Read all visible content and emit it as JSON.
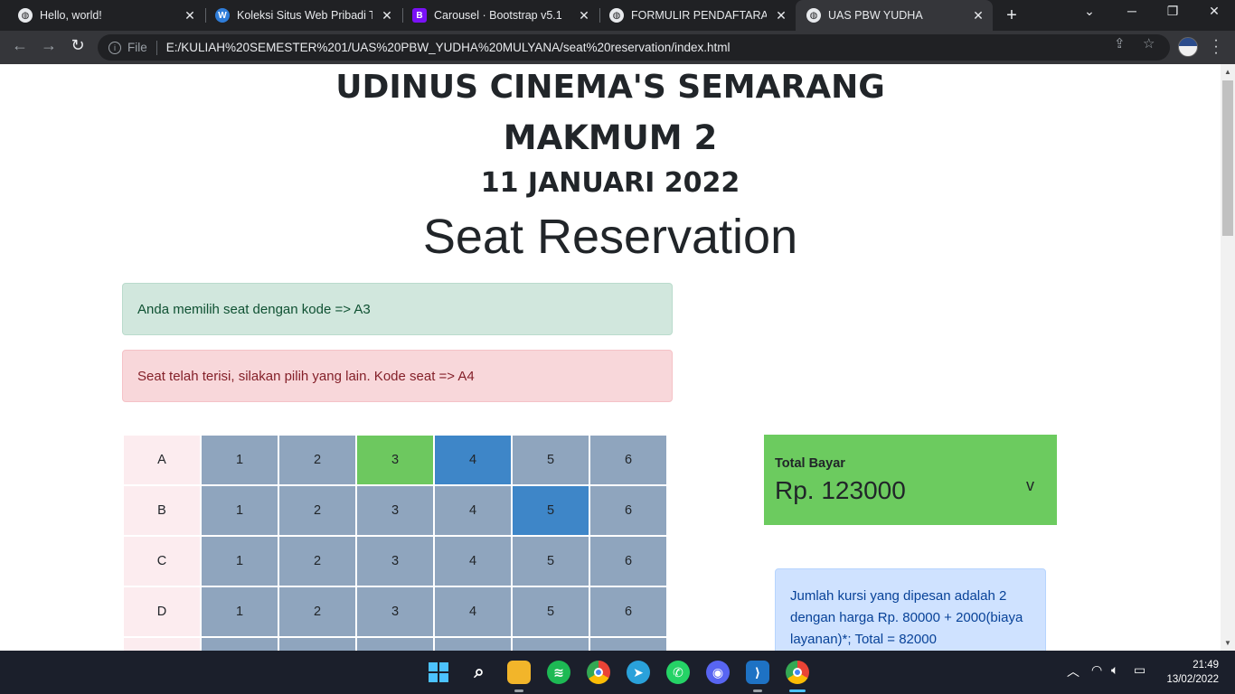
{
  "browser": {
    "tabs": [
      {
        "title": "Hello, world!",
        "icon": "globe-icon"
      },
      {
        "title": "Koleksi Situs Web Pribadi Ter",
        "icon": "wordpress-icon"
      },
      {
        "title": "Carousel · Bootstrap v5.1",
        "icon": "bootstrap-icon"
      },
      {
        "title": "FORMULIR PENDAFTARAN",
        "icon": "globe-icon"
      },
      {
        "title": "UAS PBW YUDHA",
        "icon": "globe-icon"
      }
    ],
    "active_tab": 4,
    "address": {
      "scheme_label": "File",
      "url": "E:/KULIAH%20SEMESTER%201/UAS%20PBW_YUDHA%20MULYANA/seat%20reservation/index.html"
    }
  },
  "page": {
    "title_cinema": "UDINUS CINEMA'S SEMARANG",
    "title_movie": "MAKMUM 2",
    "title_date": "11 JANUARI 2022",
    "heading": "Seat Reservation",
    "alert_success": "Anda memilih seat dengan kode => A3",
    "alert_danger": "Seat telah terisi, silakan pilih yang lain. Kode seat => A4",
    "seat_rows": [
      {
        "label": "A",
        "seats": [
          "1",
          "2",
          "3",
          "4",
          "5",
          "6"
        ],
        "states": [
          "free",
          "free",
          "selected",
          "taken",
          "free",
          "free"
        ]
      },
      {
        "label": "B",
        "seats": [
          "1",
          "2",
          "3",
          "4",
          "5",
          "6"
        ],
        "states": [
          "free",
          "free",
          "free",
          "free",
          "taken",
          "free"
        ]
      },
      {
        "label": "C",
        "seats": [
          "1",
          "2",
          "3",
          "4",
          "5",
          "6"
        ],
        "states": [
          "free",
          "free",
          "free",
          "free",
          "free",
          "free"
        ]
      },
      {
        "label": "D",
        "seats": [
          "1",
          "2",
          "3",
          "4",
          "5",
          "6"
        ],
        "states": [
          "free",
          "free",
          "free",
          "free",
          "free",
          "free"
        ]
      }
    ],
    "total": {
      "label": "Total Bayar",
      "currency": "Rp.",
      "amount": "123000",
      "toggle": "v"
    },
    "info": "Jumlah kursi yang dipesan adalah 2 dengan harga Rp. 80000 + 2000(biaya layanan)*; Total = 82000"
  },
  "taskbar": {
    "time": "21:49",
    "date": "13/02/2022"
  },
  "colors": {
    "seat_free": "#8fa5be",
    "seat_selected": "#6dc85f",
    "seat_taken": "#3e86c8",
    "total_bg": "#6ccb5f"
  }
}
